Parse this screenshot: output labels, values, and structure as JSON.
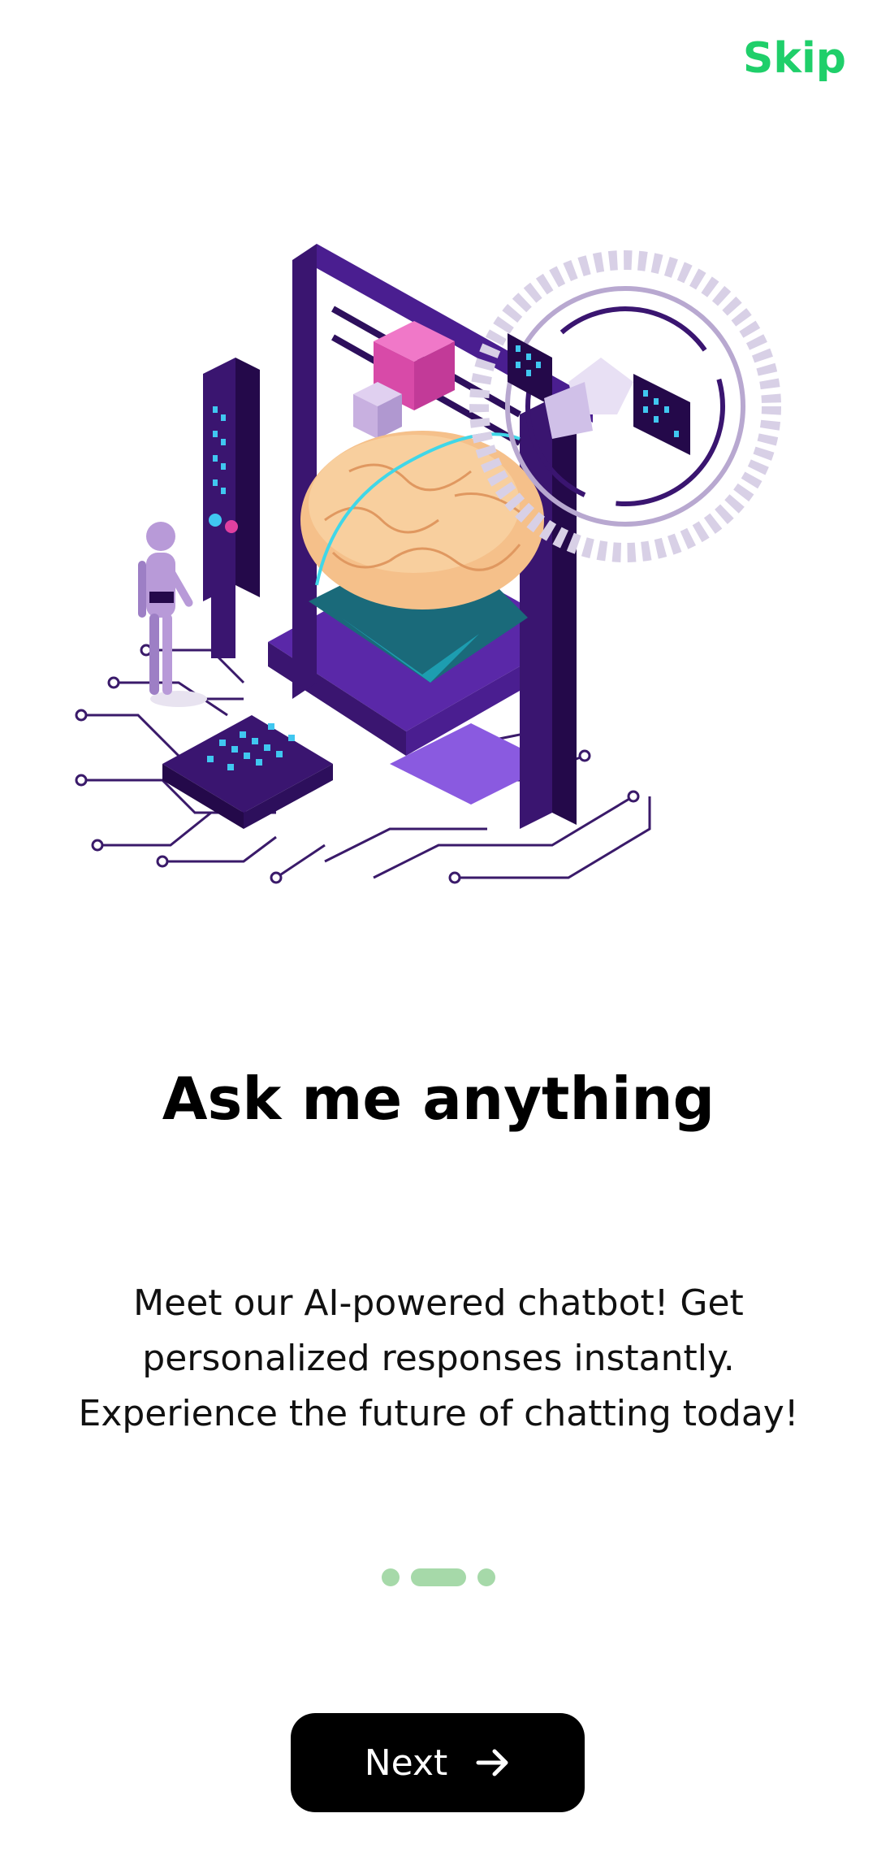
{
  "header": {
    "skip_label": "Skip"
  },
  "onboarding": {
    "title": "Ask me anything",
    "description": "Meet our AI-powered chatbot! Get personalized responses instantly. Experience the future of chatting today!",
    "page_indicator": {
      "count": 3,
      "active_index": 1
    },
    "next_label": "Next",
    "next_icon": "arrow-right-icon",
    "illustration": "ai-brain-3d-printer-illustration"
  },
  "colors": {
    "accent": "#1fcf6a",
    "indicator": "#a6d9a9",
    "button_bg": "#000000",
    "button_text": "#ffffff"
  }
}
